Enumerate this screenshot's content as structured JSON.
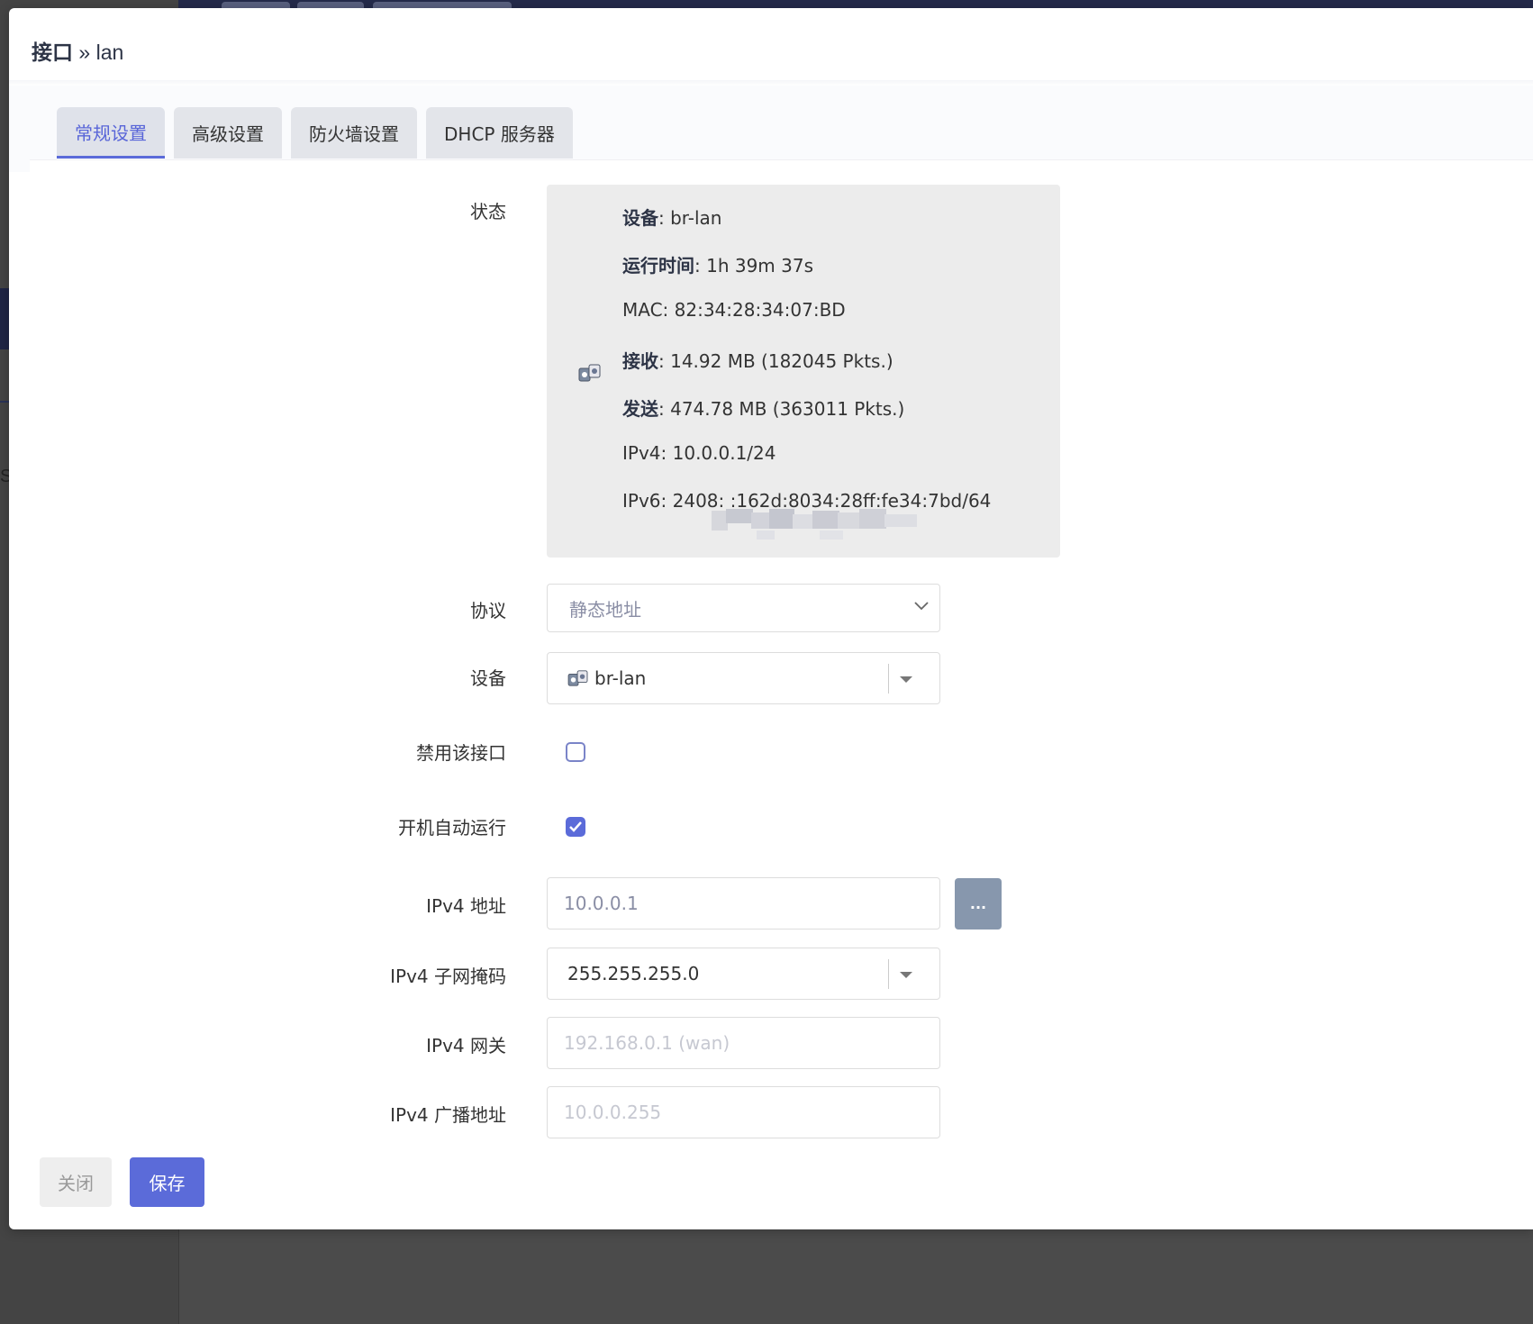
{
  "title": {
    "section": "接口",
    "separator": " » ",
    "name": "lan"
  },
  "tabs": [
    {
      "label": "常规设置",
      "active": true
    },
    {
      "label": "高级设置",
      "active": false
    },
    {
      "label": "防火墙设置",
      "active": false
    },
    {
      "label": "DHCP 服务器",
      "active": false
    }
  ],
  "status": {
    "label": "状态",
    "device_key": "设备",
    "device_val": ": br-lan",
    "uptime_key": "运行时间",
    "uptime_val": ": 1h 39m 37s",
    "mac": "MAC: 82:34:28:34:07:BD",
    "rx_key": "接收",
    "rx_val": ": 14.92 MB (182045 Pkts.)",
    "tx_key": "发送",
    "tx_val": ": 474.78 MB (363011 Pkts.)",
    "ipv4": "IPv4: 10.0.0.1/24",
    "ipv6": "IPv6: 2408:                :162d:8034:28ff:fe34:7bd/64"
  },
  "protocol": {
    "label": "协议",
    "value": "静态地址"
  },
  "device": {
    "label": "设备",
    "value": "br-lan"
  },
  "disable": {
    "label": "禁用该接口",
    "checked": false
  },
  "autostart": {
    "label": "开机自动运行",
    "checked": true
  },
  "ipv4_addr": {
    "label": "IPv4 地址",
    "value": "10.0.0.1",
    "button": "..."
  },
  "ipv4_mask": {
    "label": "IPv4 子网掩码",
    "value": "255.255.255.0"
  },
  "ipv4_gw": {
    "label": "IPv4 网关",
    "placeholder": "192.168.0.1 (wan)"
  },
  "ipv4_bcast": {
    "label": "IPv4 广播地址",
    "placeholder": "10.0.0.255"
  },
  "buttons": {
    "close": "关闭",
    "save": "保存"
  },
  "colors": {
    "accent": "#5b6bd9",
    "dark_topbar": "#242a4a",
    "status_bg": "#ececec"
  }
}
